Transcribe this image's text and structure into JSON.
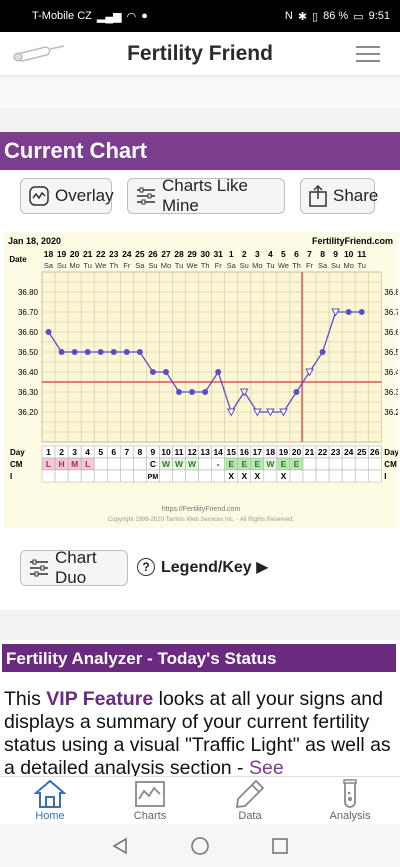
{
  "status_bar": {
    "carrier": "T-Mobile CZ",
    "battery": "86 %",
    "time": "9:51"
  },
  "app": {
    "title": "Fertility Friend"
  },
  "current_chart": {
    "header": "Current Chart",
    "buttons": {
      "overlay": "Overlay",
      "charts_like_mine": "Charts Like Mine",
      "share": "Share"
    },
    "chart_duo": "Chart Duo",
    "legend": "Legend/Key ▶"
  },
  "chart_data": {
    "type": "line",
    "start_label": "Jan 18, 2020",
    "brand": "FertilityFriend.com",
    "date_row_label": "Date",
    "dates": [
      "18",
      "19",
      "20",
      "21",
      "22",
      "23",
      "24",
      "25",
      "26",
      "27",
      "28",
      "29",
      "30",
      "31",
      "1",
      "2",
      "3",
      "4",
      "5",
      "6",
      "7",
      "8",
      "9",
      "10",
      "11"
    ],
    "weekdays": [
      "Sa",
      "Su",
      "Mo",
      "Tu",
      "We",
      "Th",
      "Fr",
      "Sa",
      "Su",
      "Mo",
      "Tu",
      "We",
      "Th",
      "Fr",
      "Sa",
      "Su",
      "Mo",
      "Tu",
      "We",
      "Th",
      "Fr",
      "Sa",
      "Su",
      "Mo",
      "Tu"
    ],
    "y_ticks": [
      "36.80",
      "36.70",
      "36.60",
      "36.50",
      "36.40",
      "36.30",
      "36.20"
    ],
    "ylim": [
      36.1,
      36.85
    ],
    "temps": [
      36.6,
      36.5,
      36.5,
      36.5,
      36.5,
      36.5,
      36.5,
      36.5,
      36.4,
      36.4,
      36.3,
      36.3,
      36.3,
      36.4,
      36.2,
      36.3,
      36.2,
      36.2,
      36.2,
      36.3,
      36.4,
      36.5,
      36.7,
      36.7,
      36.7
    ],
    "open_markers_days": [
      15,
      16,
      17,
      18,
      19,
      21,
      23
    ],
    "coverline": 36.35,
    "ovulation_day": 20,
    "day_row_label": "Day",
    "days": [
      "1",
      "2",
      "3",
      "4",
      "5",
      "6",
      "7",
      "8",
      "9",
      "10",
      "11",
      "12",
      "13",
      "14",
      "15",
      "16",
      "17",
      "18",
      "19",
      "20",
      "21",
      "22",
      "23",
      "24",
      "25",
      "26"
    ],
    "cm_label": "CM",
    "cm": [
      "L",
      "H",
      "M",
      "L",
      "",
      "",
      "",
      "",
      "C",
      "W",
      "W",
      "W",
      "",
      "-",
      "E",
      "E",
      "E",
      "W",
      "E",
      "E",
      "",
      "",
      "",
      "",
      "",
      ""
    ],
    "i_label": "I",
    "intercourse": [
      "",
      "",
      "",
      "",
      "",
      "",
      "",
      "",
      "PM",
      "",
      "",
      "",
      "",
      "",
      "X",
      "X",
      "X",
      "",
      "X",
      "",
      "",
      "",
      "",
      "",
      "",
      ""
    ],
    "footer_url": "https://FertilityFriend.com",
    "copyright": "Copyright 1998-2020 Tamtris Web Services Inc. - All Rights Reserved."
  },
  "analyzer": {
    "header": "Fertility Analyzer - Today's Status",
    "text_before": "This ",
    "vip": "VIP Feature",
    "text_after": " looks at all your signs and displays a summary of your current fertility status using a visual \"Traffic Light\" as well as a detailed analysis section - ",
    "see": "See"
  },
  "nav": [
    {
      "label": "Home",
      "icon": "home-icon",
      "active": true
    },
    {
      "label": "Charts",
      "icon": "chart-icon",
      "active": false
    },
    {
      "label": "Data",
      "icon": "pencil-icon",
      "active": false
    },
    {
      "label": "Analysis",
      "icon": "test-tube-icon",
      "active": false
    }
  ],
  "colors": {
    "header_purple": "#7b3e8f",
    "chart_bg": "#fdfbe3",
    "temp_line": "#5a4fc8",
    "coverline": "#d23b3b",
    "active_nav": "#3a6fb0"
  }
}
